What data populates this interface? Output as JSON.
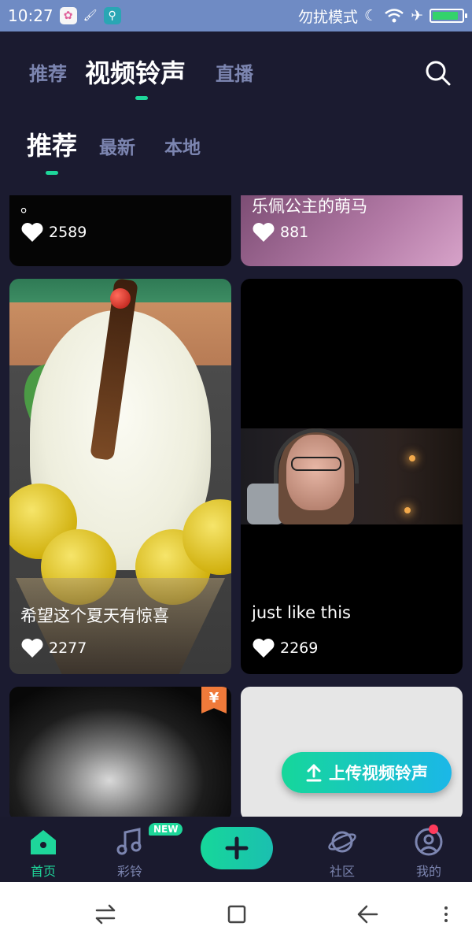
{
  "status_bar": {
    "time": "10:27",
    "dnd_label": "勿扰模式",
    "battery_color": "#33d36b"
  },
  "top_tabs": {
    "items": [
      "推荐",
      "视频铃声",
      "直播"
    ],
    "active": "视频铃声",
    "accent": "#1ed69a"
  },
  "sub_tabs": {
    "items": [
      "推荐",
      "最新",
      "本地"
    ],
    "active": "推荐"
  },
  "cards": [
    {
      "title": "。",
      "likes": "2589"
    },
    {
      "title": "乐佩公主的萌马",
      "likes": "881"
    },
    {
      "title": "希望这个夏天有惊喜",
      "likes": "2277"
    },
    {
      "title": "just like this",
      "likes": "2269"
    },
    {
      "title": "",
      "likes": "",
      "price_tag": "¥"
    },
    {
      "title": "",
      "likes": ""
    }
  ],
  "upload_button": {
    "label": "上传视频铃声"
  },
  "bottom_nav": {
    "items": [
      {
        "label": "首页",
        "icon": "home-icon",
        "active": true
      },
      {
        "label": "彩铃",
        "icon": "music-note-icon",
        "badge": "NEW"
      },
      {
        "label": "",
        "icon": "plus-icon"
      },
      {
        "label": "社区",
        "icon": "planet-icon"
      },
      {
        "label": "我的",
        "icon": "profile-icon"
      }
    ]
  },
  "system_nav": [
    "switch-icon",
    "square-icon",
    "back-icon",
    "menu-icon"
  ]
}
